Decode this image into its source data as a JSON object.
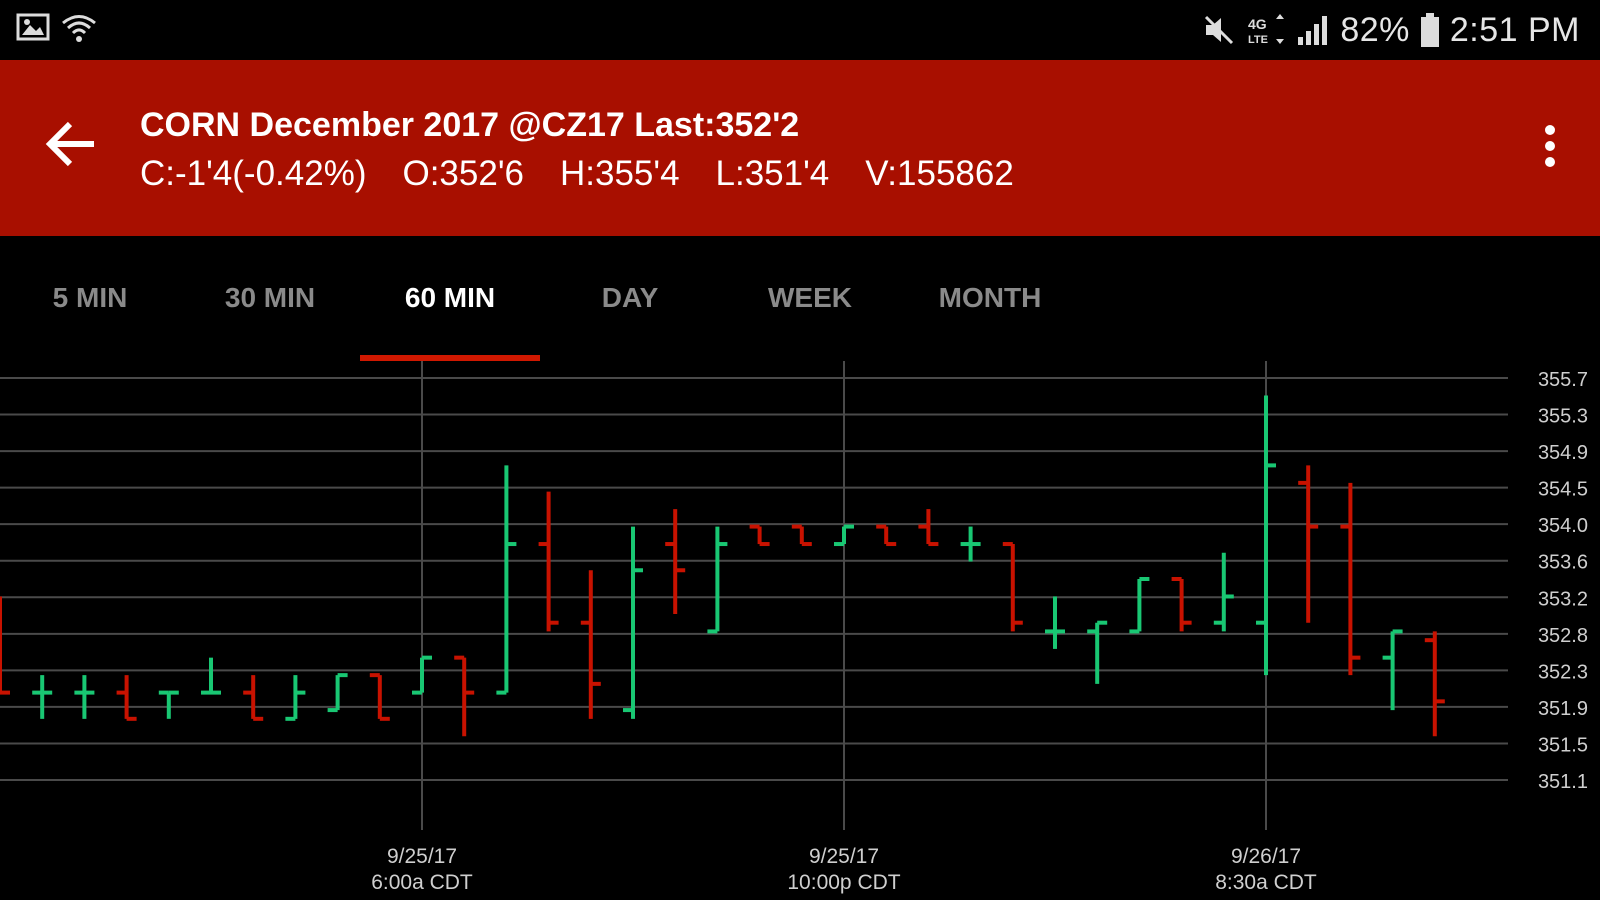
{
  "status_bar": {
    "icons_left": [
      "image-icon",
      "wifi-icon"
    ],
    "icons_right": [
      "mute-icon",
      "4g-lte-icon",
      "signal-icon",
      "battery-icon"
    ],
    "battery": "82%",
    "time": "2:51 PM"
  },
  "header": {
    "title": "CORN December 2017 @CZ17 Last:352'2",
    "stats": {
      "change": "C:-1'4(-0.42%)",
      "open": "O:352'6",
      "high": "H:355'4",
      "low": "L:351'4",
      "volume": "V:155862"
    },
    "back_icon": "arrow-back-icon",
    "menu_icon": "overflow-menu-icon",
    "color": "#a80f00"
  },
  "tabs": {
    "items": [
      "5 MIN",
      "30 MIN",
      "60 MIN",
      "DAY",
      "WEEK",
      "MONTH"
    ],
    "active": "60 MIN",
    "indicator_color": "#d01800"
  },
  "chart_data": {
    "type": "ohlc",
    "title": "",
    "xlabel": "",
    "ylabel": "",
    "ylim": [
      351.0,
      355.8
    ],
    "y_ticks": [
      "355.7",
      "355.3",
      "354.9",
      "354.5",
      "354.0",
      "353.6",
      "353.2",
      "352.8",
      "352.3",
      "351.9",
      "351.5",
      "351.1"
    ],
    "x_labels": [
      {
        "date": "9/25/17",
        "time": "6:00a CDT",
        "bar": 10
      },
      {
        "date": "9/25/17",
        "time": "10:00p CDT",
        "bar": 20
      },
      {
        "date": "9/26/17",
        "time": "8:30a CDT",
        "bar": 30
      }
    ],
    "grid": true,
    "up_color": "#19c773",
    "down_color": "#c81200",
    "bars": [
      {
        "o": 352.6,
        "h": 353.2,
        "l": 352.1,
        "c": 352.1
      },
      {
        "o": 352.1,
        "h": 352.3,
        "l": 351.8,
        "c": 352.1
      },
      {
        "o": 352.1,
        "h": 352.3,
        "l": 351.8,
        "c": 352.1
      },
      {
        "o": 352.1,
        "h": 352.3,
        "l": 351.8,
        "c": 351.8
      },
      {
        "o": 352.1,
        "h": 352.1,
        "l": 351.8,
        "c": 352.1
      },
      {
        "o": 352.1,
        "h": 352.5,
        "l": 352.1,
        "c": 352.1
      },
      {
        "o": 352.1,
        "h": 352.3,
        "l": 351.8,
        "c": 351.8
      },
      {
        "o": 351.8,
        "h": 352.3,
        "l": 351.8,
        "c": 352.1
      },
      {
        "o": 351.9,
        "h": 352.3,
        "l": 351.9,
        "c": 352.3
      },
      {
        "o": 352.3,
        "h": 352.3,
        "l": 351.8,
        "c": 351.8
      },
      {
        "o": 352.1,
        "h": 352.5,
        "l": 352.1,
        "c": 352.5
      },
      {
        "o": 352.5,
        "h": 352.5,
        "l": 351.6,
        "c": 352.1
      },
      {
        "o": 352.1,
        "h": 354.7,
        "l": 352.1,
        "c": 353.8
      },
      {
        "o": 353.8,
        "h": 354.4,
        "l": 352.8,
        "c": 352.9
      },
      {
        "o": 352.9,
        "h": 353.5,
        "l": 351.8,
        "c": 352.2
      },
      {
        "o": 351.9,
        "h": 354.0,
        "l": 351.8,
        "c": 353.5
      },
      {
        "o": 353.8,
        "h": 354.2,
        "l": 353.0,
        "c": 353.5
      },
      {
        "o": 352.8,
        "h": 354.0,
        "l": 352.8,
        "c": 353.8
      },
      {
        "o": 354.0,
        "h": 354.0,
        "l": 353.8,
        "c": 353.8
      },
      {
        "o": 354.0,
        "h": 354.0,
        "l": 353.8,
        "c": 353.8
      },
      {
        "o": 353.8,
        "h": 354.0,
        "l": 353.8,
        "c": 354.0
      },
      {
        "o": 354.0,
        "h": 354.0,
        "l": 353.8,
        "c": 353.8
      },
      {
        "o": 354.0,
        "h": 354.2,
        "l": 353.8,
        "c": 353.8
      },
      {
        "o": 353.8,
        "h": 354.0,
        "l": 353.6,
        "c": 353.8
      },
      {
        "o": 353.8,
        "h": 353.8,
        "l": 352.8,
        "c": 352.9
      },
      {
        "o": 352.8,
        "h": 353.2,
        "l": 352.6,
        "c": 352.8
      },
      {
        "o": 352.8,
        "h": 352.9,
        "l": 352.2,
        "c": 352.9
      },
      {
        "o": 352.8,
        "h": 353.4,
        "l": 352.8,
        "c": 353.4
      },
      {
        "o": 353.4,
        "h": 353.4,
        "l": 352.8,
        "c": 352.9
      },
      {
        "o": 352.9,
        "h": 353.7,
        "l": 352.8,
        "c": 353.2
      },
      {
        "o": 352.9,
        "h": 355.5,
        "l": 352.3,
        "c": 354.7
      },
      {
        "o": 354.5,
        "h": 354.7,
        "l": 352.9,
        "c": 354.0
      },
      {
        "o": 354.0,
        "h": 354.5,
        "l": 352.3,
        "c": 352.5
      },
      {
        "o": 352.5,
        "h": 352.8,
        "l": 351.9,
        "c": 352.8
      },
      {
        "o": 352.7,
        "h": 352.8,
        "l": 351.6,
        "c": 352.0
      }
    ]
  }
}
